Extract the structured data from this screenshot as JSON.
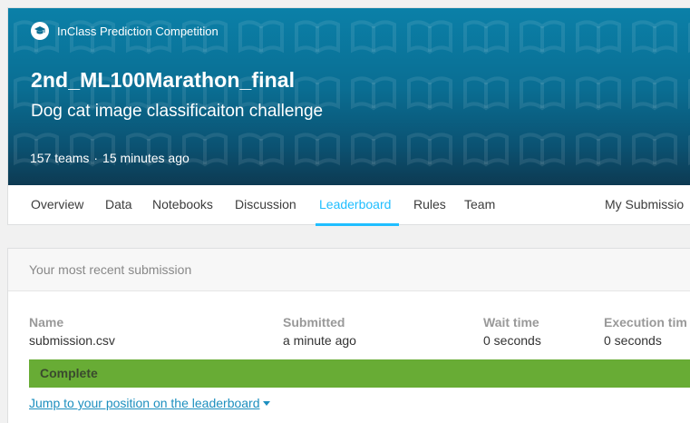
{
  "banner": {
    "badge": "InClass Prediction Competition",
    "badge_icon": "graduation-cap-icon",
    "title": "2nd_ML100Marathon_final",
    "subtitle": "Dog cat image classificaiton challenge",
    "teams": "157 teams",
    "separator": "·",
    "time_ago": "15 minutes ago",
    "colors": {
      "top": "#0b80a8",
      "bottom": "#0d3a52"
    }
  },
  "tabs": [
    {
      "label": "Overview"
    },
    {
      "label": "Data"
    },
    {
      "label": "Notebooks"
    },
    {
      "label": "Discussion"
    },
    {
      "label": "Leaderboard",
      "active": true
    },
    {
      "label": "Rules"
    },
    {
      "label": "Team"
    },
    {
      "label": "My Submissio"
    }
  ],
  "accent_color": "#20beff",
  "submission": {
    "header": "Your most recent submission",
    "columns": {
      "name": {
        "label": "Name",
        "value": "submission.csv"
      },
      "submitted": {
        "label": "Submitted",
        "value": "a minute ago"
      },
      "wait": {
        "label": "Wait time",
        "value": "0 seconds"
      },
      "exec": {
        "label": "Execution tim",
        "value": "0 seconds"
      }
    },
    "status": "Complete",
    "status_color": "#68ac35",
    "jump_link": "Jump to your position on the leaderboard"
  }
}
